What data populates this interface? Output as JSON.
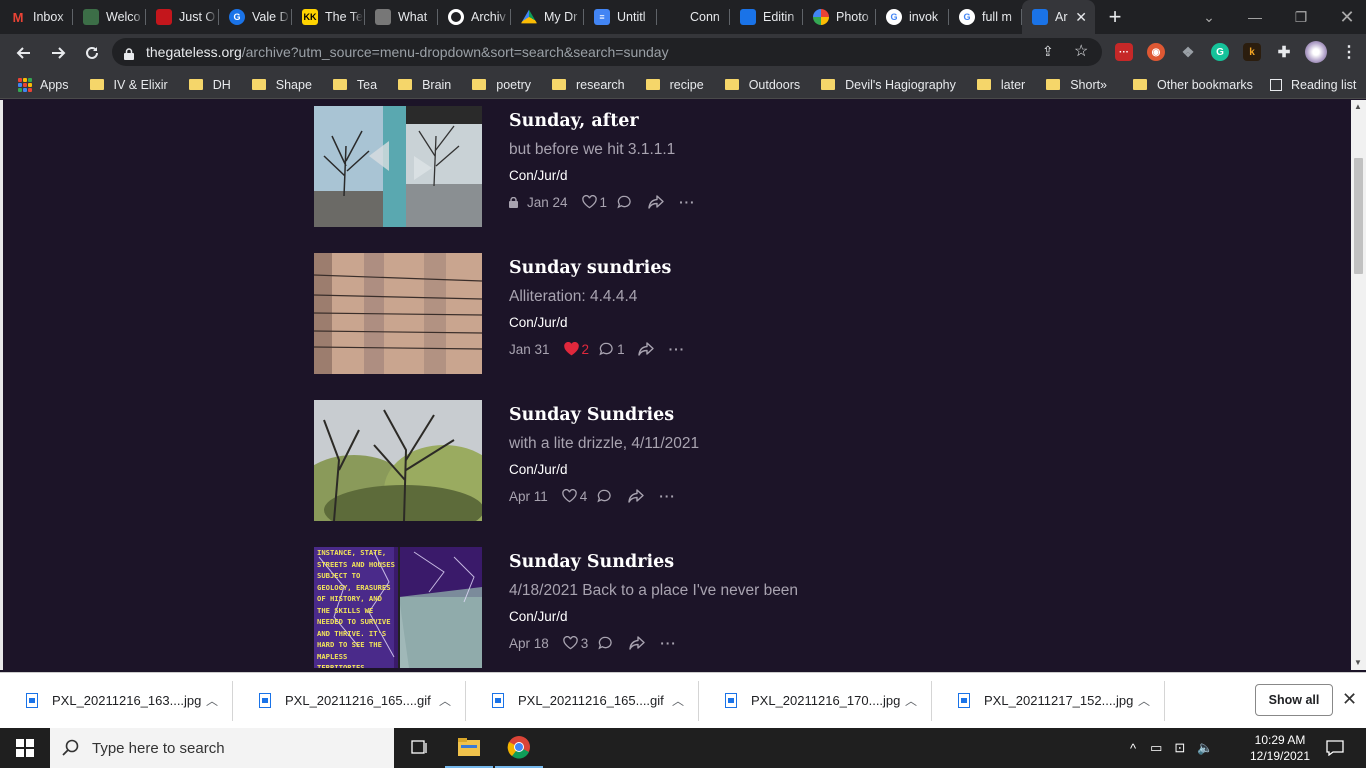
{
  "browser": {
    "tabs": [
      {
        "title": "Inbox",
        "icon": "gmail-icon",
        "color": "#ea4335"
      },
      {
        "title": "Welco",
        "icon": "page-icon",
        "color": "#3c6e47"
      },
      {
        "title": "Just O",
        "icon": "red-logo-icon",
        "color": "#c4161c"
      },
      {
        "title": "Vale D",
        "icon": "g-logo-icon",
        "color": "#1a73e8"
      },
      {
        "title": "The Te",
        "icon": "kk-icon",
        "color": "#ffd400"
      },
      {
        "title": "What",
        "icon": "film-icon",
        "color": "#777777"
      },
      {
        "title": "Archiv",
        "icon": "globe-icon",
        "color": "#ffffff"
      },
      {
        "title": "My Dr",
        "icon": "drive-icon",
        "color": "#fbbc04"
      },
      {
        "title": "Untitl",
        "icon": "docs-icon",
        "color": "#4285f4"
      },
      {
        "title": "Conn",
        "icon": "blank-icon",
        "color": "#202124"
      },
      {
        "title": "Editin",
        "icon": "substack-icon",
        "color": "#1a73e8"
      },
      {
        "title": "Photo",
        "icon": "photos-icon",
        "color": "#fbbc04"
      },
      {
        "title": "invok",
        "icon": "google-icon",
        "color": "#ffffff"
      },
      {
        "title": "full m",
        "icon": "google-icon",
        "color": "#ffffff"
      },
      {
        "title": "Ar",
        "icon": "substack-icon",
        "color": "#1a73e8",
        "active": true
      }
    ],
    "url_host": "thegateless.org",
    "url_path": "/archive?utm_source=menu-dropdown&sort=search&search=sunday",
    "bookmarks": [
      "Apps",
      "IV & Elixir",
      "DH",
      "Shape",
      "Tea",
      "Brain",
      "poetry",
      "research",
      "recipe",
      "Outdoors",
      "Devil's Hagiography",
      "later",
      "Short"
    ],
    "other_bookmarks": "Other bookmarks",
    "reading_list": "Reading list",
    "overflow": "»"
  },
  "posts": [
    {
      "title": "Sunday, after",
      "subtitle": "but before we hit 3.1.1.1",
      "author": "Con/Jur/d",
      "date": "Jan 24",
      "likes": "1",
      "liked": false,
      "comments": "",
      "locked": true
    },
    {
      "title": "Sunday sundries",
      "subtitle": "Alliteration: 4.4.4.4",
      "author": "Con/Jur/d",
      "date": "Jan 31",
      "likes": "2",
      "liked": true,
      "comments": "1",
      "locked": false
    },
    {
      "title": "Sunday Sundries",
      "subtitle": "with a lite drizzle, 4/11/2021",
      "author": "Con/Jur/d",
      "date": "Apr 11",
      "likes": "4",
      "liked": false,
      "comments": "",
      "locked": false
    },
    {
      "title": "Sunday Sundries",
      "subtitle": "4/18/2021 Back to a place I've never been",
      "author": "Con/Jur/d",
      "date": "Apr 18",
      "likes": "3",
      "liked": false,
      "comments": "",
      "locked": false
    }
  ],
  "thumb4_text": "INSTANCE, STATE, STREETS AND HOUSES SUBJECT TO GEOLOGY, ERASURES OF HISTORY, AND THE SKILLS WE NEEDED TO SURVIVE AND THRIVE. IT'S HARD TO SEE THE MAPLESS TERRITORIES",
  "downloads": {
    "files": [
      "PXL_20211216_163....jpg",
      "PXL_20211216_165....gif",
      "PXL_20211216_165....gif",
      "PXL_20211216_170....jpg",
      "PXL_20211217_152....jpg"
    ],
    "show_all": "Show all"
  },
  "taskbar": {
    "search_placeholder": "Type here to search",
    "time": "10:29 AM",
    "date": "12/19/2021"
  },
  "colors": {
    "page_bg": "#1c1428",
    "heart": "#e0283c",
    "muted": "#a8a3b0"
  }
}
